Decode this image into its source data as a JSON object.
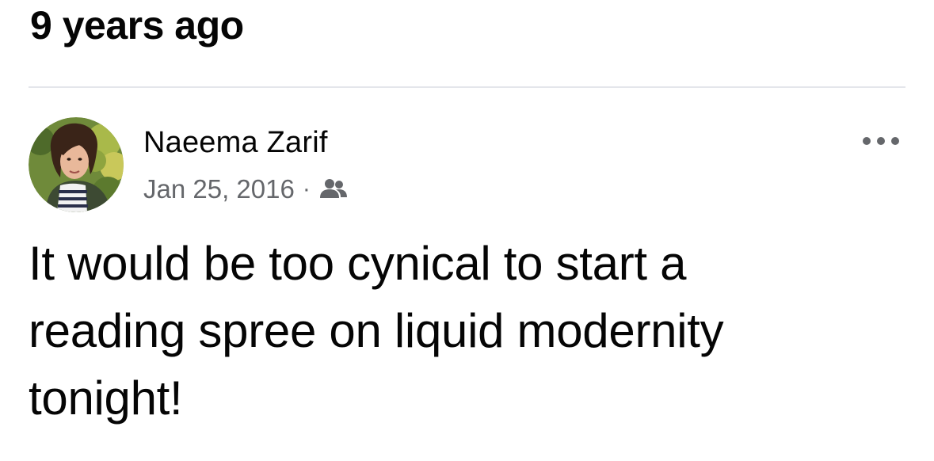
{
  "section": {
    "title": "9 years ago"
  },
  "post": {
    "author_name": "Naeema Zarif",
    "date": "Jan 25, 2016",
    "separator": "·",
    "audience_icon": "friends-icon",
    "more_icon": "more-horizontal-icon",
    "text": "It would be too cynical to start a reading spree on liquid modernity tonight!"
  },
  "colors": {
    "primary_text": "#050505",
    "secondary_text": "#65676b",
    "divider": "#e4e6eb",
    "background": "#ffffff"
  }
}
